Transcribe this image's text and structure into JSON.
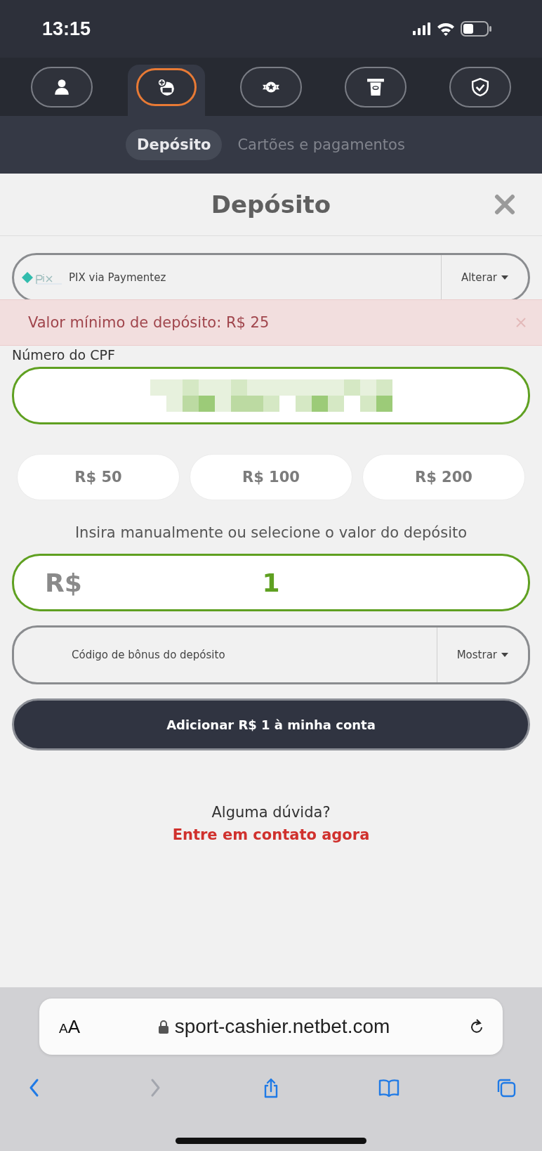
{
  "status_bar": {
    "time": "13:15"
  },
  "nav_tabs": [
    {
      "selected": false
    },
    {
      "selected": true
    },
    {
      "selected": false
    },
    {
      "selected": false
    },
    {
      "selected": false
    }
  ],
  "sub_tabs": [
    {
      "label": "Depósito",
      "selected": true
    },
    {
      "label": "Cartões e pagamentos",
      "selected": false
    }
  ],
  "dialog": {
    "title": "Depósito",
    "payment_method": {
      "name": "PIX via Paymentez",
      "action": "Alterar"
    },
    "alert": {
      "message": "Valor mínimo de depósito: R$ 25"
    },
    "cpf": {
      "label": "Número do CPF"
    },
    "presets": [
      {
        "label": "R$ 50"
      },
      {
        "label": "R$ 100"
      },
      {
        "label": "R$ 200"
      }
    ],
    "instruction": "Insira manualmente ou selecione o valor do depósito",
    "amount": {
      "currency": "R$",
      "value": "1"
    },
    "bonus": {
      "placeholder": "Código de bônus do depósito",
      "action": "Mostrar"
    },
    "submit": "Adicionar R$ 1 à minha conta",
    "help": {
      "question": "Alguma dúvida?",
      "link": "Entre em contato agora"
    }
  },
  "browser": {
    "text_size": "AA",
    "url": "sport-cashier.netbet.com",
    "toolbar": [
      {
        "disabled": false
      },
      {
        "disabled": true
      },
      {
        "disabled": false
      },
      {
        "disabled": false
      },
      {
        "disabled": false
      }
    ]
  }
}
